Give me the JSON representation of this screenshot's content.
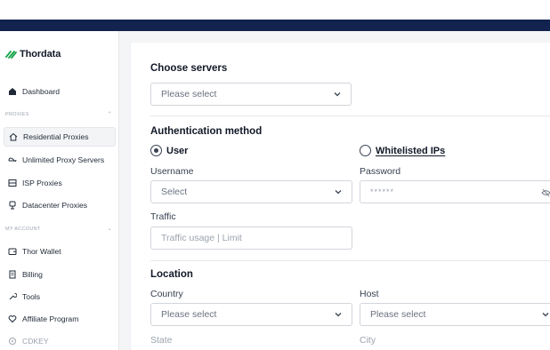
{
  "brand": {
    "name": "Thordata"
  },
  "sidebar": {
    "dashboard": "Dashboard",
    "sections": {
      "proxies": "PROXIES",
      "my_account": "MY ACCOUNT"
    },
    "proxies_items": [
      {
        "label": "Residential Proxies",
        "icon": "home-icon",
        "active": true
      },
      {
        "label": "Unlimited Proxy Servers",
        "icon": "infinity-icon"
      },
      {
        "label": "ISP Proxies",
        "icon": "server-icon"
      },
      {
        "label": "Datacenter Proxies",
        "icon": "database-icon"
      }
    ],
    "account_items": [
      {
        "label": "Thor Wallet",
        "icon": "wallet-icon"
      },
      {
        "label": "Billing",
        "icon": "receipt-icon"
      },
      {
        "label": "Tools",
        "icon": "tools-icon"
      },
      {
        "label": "Affiliate Program",
        "icon": "handshake-icon"
      },
      {
        "label": "CDKEY",
        "icon": "key-icon"
      }
    ]
  },
  "form": {
    "choose_servers": {
      "title": "Choose servers",
      "placeholder": "Please select"
    },
    "auth": {
      "title": "Authentication method",
      "option_user": "User",
      "option_whitelist": "Whitelisted IPs",
      "selected": "User",
      "username_label": "Username",
      "username_placeholder": "Select",
      "password_label": "Password",
      "password_value": "******",
      "traffic_label": "Traffic",
      "traffic_placeholder": "Traffic usage | Limit"
    },
    "location": {
      "title": "Location",
      "country_label": "Country",
      "country_placeholder": "Please select",
      "host_label": "Host",
      "host_placeholder": "Please select",
      "state_label": "State",
      "city_label": "City"
    }
  },
  "colors": {
    "nav_band": "#13234f",
    "brand_green": "#16a34a"
  }
}
